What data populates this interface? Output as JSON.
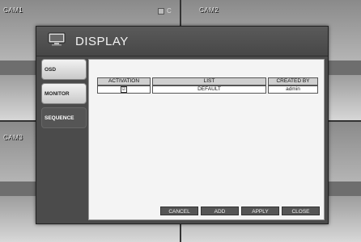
{
  "cameras": [
    {
      "label": "CAM1"
    },
    {
      "label": "CAM2"
    },
    {
      "label": "CAM3"
    }
  ],
  "status_badge": {
    "text": "C"
  },
  "dialog": {
    "title": "DISPLAY",
    "icon": "monitor-icon"
  },
  "side_menu": {
    "items": [
      {
        "label": "OSD",
        "active": false
      },
      {
        "label": "MONITOR",
        "active": false
      },
      {
        "label": "SEQUENCE",
        "active": true
      }
    ]
  },
  "table": {
    "headers": [
      "ACTIVATION",
      "LIST",
      "CREATED BY"
    ],
    "rows": [
      {
        "activation": "☑",
        "list": "DEFAULT",
        "created_by": "admin"
      }
    ]
  },
  "buttons": {
    "cancel": "CANCEL",
    "add": "ADD",
    "apply": "APPLY",
    "close": "CLOSE"
  }
}
